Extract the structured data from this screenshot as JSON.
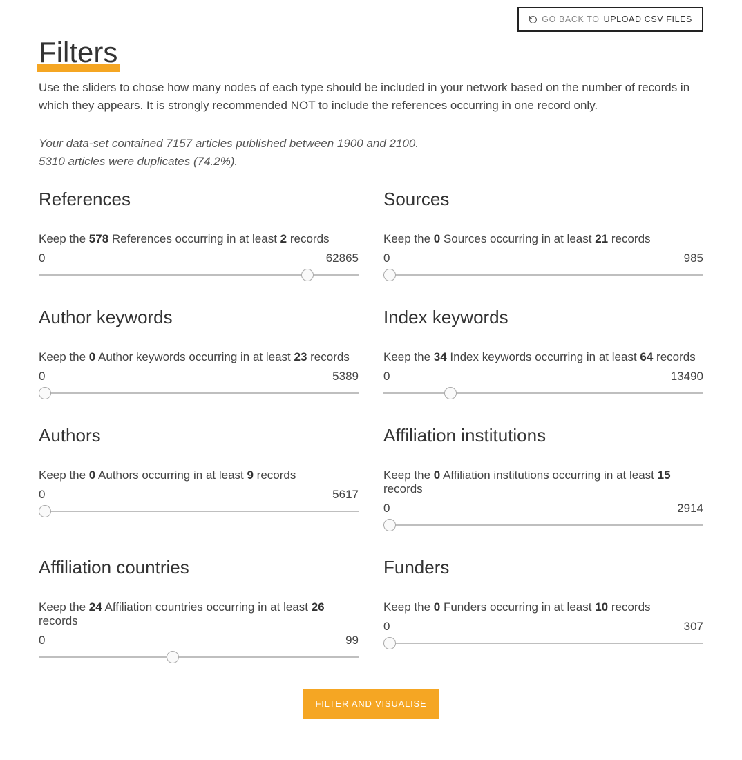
{
  "header": {
    "go_back_lead": "GO BACK TO ",
    "go_back_tail": "UPLOAD CSV FILES"
  },
  "title": "Filters",
  "intro": "Use the sliders to chose how many nodes of each type should be included in your network based on the number of records in which they appears. It is strongly recommended NOT to include the references occurring in one record only.",
  "stats_line1": "Your data-set contained 7157 articles published between 1900 and 2100.",
  "stats_line2": "5310 articles were duplicates (74.2%).",
  "filters": {
    "references": {
      "heading": "References",
      "keep_prefix": "Keep the ",
      "count": "578",
      "middle": " References occurring in at least ",
      "threshold": "2",
      "suffix": " records",
      "min": "0",
      "max": "62865",
      "position_pct": 84
    },
    "sources": {
      "heading": "Sources",
      "keep_prefix": "Keep the ",
      "count": "0",
      "middle": " Sources occurring in at least ",
      "threshold": "21",
      "suffix": " records",
      "min": "0",
      "max": "985",
      "position_pct": 2
    },
    "author_keywords": {
      "heading": "Author keywords",
      "keep_prefix": "Keep the ",
      "count": "0",
      "middle": " Author keywords occurring in at least ",
      "threshold": "23",
      "suffix": " records",
      "min": "0",
      "max": "5389",
      "position_pct": 2
    },
    "index_keywords": {
      "heading": "Index keywords",
      "keep_prefix": "Keep the ",
      "count": "34",
      "middle": " Index keywords occurring in at least ",
      "threshold": "64",
      "suffix": " records",
      "min": "0",
      "max": "13490",
      "position_pct": 21
    },
    "authors": {
      "heading": "Authors",
      "keep_prefix": "Keep the ",
      "count": "0",
      "middle": " Authors occurring in at least ",
      "threshold": "9",
      "suffix": " records",
      "min": "0",
      "max": "5617",
      "position_pct": 2
    },
    "affiliation_institutions": {
      "heading": "Affiliation institutions",
      "keep_prefix": "Keep the ",
      "count": "0",
      "middle": " Affiliation institutions occurring in at least ",
      "threshold": "15",
      "suffix": " records",
      "min": "0",
      "max": "2914",
      "position_pct": 2
    },
    "affiliation_countries": {
      "heading": "Affiliation countries",
      "keep_prefix": "Keep the ",
      "count": "24",
      "middle": " Affiliation countries occurring in at least ",
      "threshold": "26",
      "suffix": " records",
      "min": "0",
      "max": "99",
      "position_pct": 42
    },
    "funders": {
      "heading": "Funders",
      "keep_prefix": "Keep the ",
      "count": "0",
      "middle": " Funders occurring in at least ",
      "threshold": "10",
      "suffix": " records",
      "min": "0",
      "max": "307",
      "position_pct": 2
    }
  },
  "submit_label": "FILTER AND VISUALISE"
}
